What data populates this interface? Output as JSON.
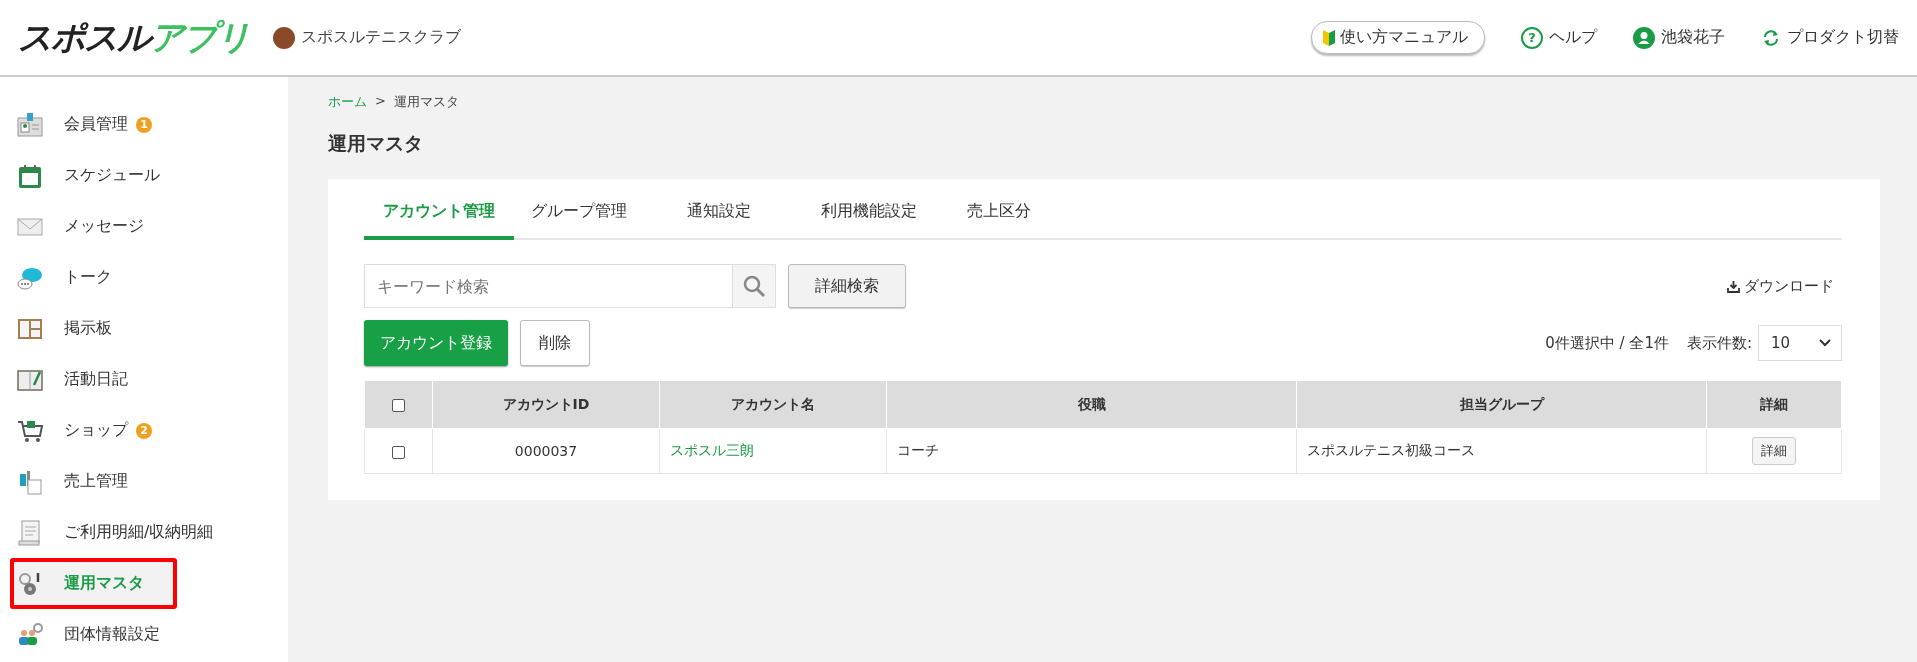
{
  "header": {
    "logo": {
      "part_1": "スポスル",
      "part_2": "アプリ"
    },
    "club_name": "スポスルテニスクラブ",
    "manual_button": "使い方マニュアル",
    "help_icon": "?",
    "help_link": "ヘルプ",
    "user_name": "池袋花子",
    "product_switch": "プロダクト切替"
  },
  "sidebar": {
    "items": [
      {
        "label": "会員管理",
        "kind": "member",
        "badge": "1",
        "selected": false,
        "outlined": false
      },
      {
        "label": "スケジュール",
        "kind": "calendar",
        "selected": false,
        "outlined": false
      },
      {
        "label": "メッセージ",
        "kind": "mail",
        "selected": false,
        "outlined": false
      },
      {
        "label": "トーク",
        "kind": "chat",
        "selected": false,
        "outlined": false
      },
      {
        "label": "掲示板",
        "kind": "board",
        "selected": false,
        "outlined": false
      },
      {
        "label": "活動日記",
        "kind": "diary",
        "selected": false,
        "outlined": false
      },
      {
        "label": "ショップ",
        "kind": "cart",
        "badge": "2",
        "selected": false,
        "outlined": false
      },
      {
        "label": "売上管理",
        "kind": "sales",
        "selected": false,
        "outlined": false
      },
      {
        "label": "ご利用明細/収納明細",
        "kind": "receipt",
        "selected": false,
        "outlined": false
      },
      {
        "label": "運用マスタ",
        "kind": "gears",
        "selected": true,
        "outlined": true
      },
      {
        "label": "団体情報設定",
        "kind": "group",
        "selected": false,
        "outlined": false
      }
    ]
  },
  "breadcrumb": {
    "home": "ホーム",
    "separator": ">",
    "current": "運用マスタ"
  },
  "page_title": "運用マスタ",
  "tabs": [
    {
      "label": "アカウント管理",
      "selected": true
    },
    {
      "label": "グループ管理",
      "selected": false
    },
    {
      "label": "通知設定",
      "selected": false
    },
    {
      "label": "利用機能設定",
      "selected": false
    },
    {
      "label": "売上区分",
      "selected": false
    }
  ],
  "search": {
    "placeholder": "キーワード検索",
    "advanced_button": "詳細検索"
  },
  "download_link": "ダウンロード",
  "actions": {
    "register_button": "アカウント登録",
    "delete_button": "削除"
  },
  "selection_summary": "0件選択中 / 全1件",
  "page_size": {
    "label": "表示件数:",
    "value": "10"
  },
  "table": {
    "select_all_checked": false,
    "columns": [
      "アカウントID",
      "アカウント名",
      "役職",
      "担当グループ",
      "詳細"
    ],
    "rows": [
      {
        "checked": false,
        "account_id": "0000037",
        "account_name": "スポスル三朗",
        "role": "コーチ",
        "group": "スポスルテニス初級コース",
        "detail_button": "詳細"
      }
    ]
  }
}
